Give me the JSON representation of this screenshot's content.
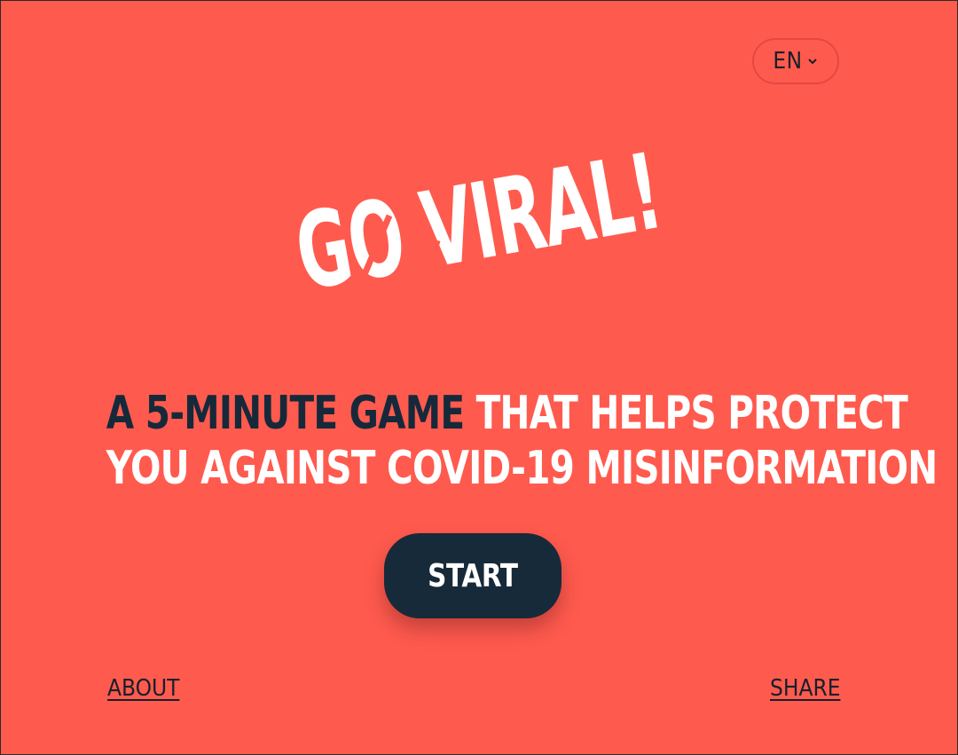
{
  "colors": {
    "background": "#ff5a4e",
    "primary_dark": "#172a3a",
    "white": "#ffffff",
    "text_dark": "#16202b"
  },
  "language": {
    "selected": "EN",
    "icon": "chevron-down-icon"
  },
  "logo": {
    "text": "GO VIRAL!"
  },
  "tagline": {
    "highlight": "A 5-MINUTE GAME",
    "line1_rest": "THAT HELPS PROTECT",
    "line2": "YOU AGAINST COVID-19 MISINFORMATION"
  },
  "start_button": {
    "label": "START"
  },
  "footer": {
    "about_label": "ABOUT",
    "share_label": "SHARE"
  }
}
